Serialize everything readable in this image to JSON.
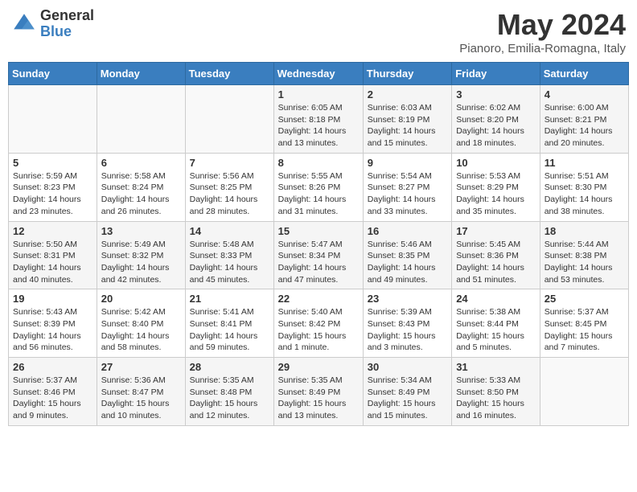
{
  "logo": {
    "general": "General",
    "blue": "Blue"
  },
  "header": {
    "month": "May 2024",
    "location": "Pianoro, Emilia-Romagna, Italy"
  },
  "weekdays": [
    "Sunday",
    "Monday",
    "Tuesday",
    "Wednesday",
    "Thursday",
    "Friday",
    "Saturday"
  ],
  "weeks": [
    [
      {
        "day": "",
        "info": ""
      },
      {
        "day": "",
        "info": ""
      },
      {
        "day": "",
        "info": ""
      },
      {
        "day": "1",
        "info": "Sunrise: 6:05 AM\nSunset: 8:18 PM\nDaylight: 14 hours\nand 13 minutes."
      },
      {
        "day": "2",
        "info": "Sunrise: 6:03 AM\nSunset: 8:19 PM\nDaylight: 14 hours\nand 15 minutes."
      },
      {
        "day": "3",
        "info": "Sunrise: 6:02 AM\nSunset: 8:20 PM\nDaylight: 14 hours\nand 18 minutes."
      },
      {
        "day": "4",
        "info": "Sunrise: 6:00 AM\nSunset: 8:21 PM\nDaylight: 14 hours\nand 20 minutes."
      }
    ],
    [
      {
        "day": "5",
        "info": "Sunrise: 5:59 AM\nSunset: 8:23 PM\nDaylight: 14 hours\nand 23 minutes."
      },
      {
        "day": "6",
        "info": "Sunrise: 5:58 AM\nSunset: 8:24 PM\nDaylight: 14 hours\nand 26 minutes."
      },
      {
        "day": "7",
        "info": "Sunrise: 5:56 AM\nSunset: 8:25 PM\nDaylight: 14 hours\nand 28 minutes."
      },
      {
        "day": "8",
        "info": "Sunrise: 5:55 AM\nSunset: 8:26 PM\nDaylight: 14 hours\nand 31 minutes."
      },
      {
        "day": "9",
        "info": "Sunrise: 5:54 AM\nSunset: 8:27 PM\nDaylight: 14 hours\nand 33 minutes."
      },
      {
        "day": "10",
        "info": "Sunrise: 5:53 AM\nSunset: 8:29 PM\nDaylight: 14 hours\nand 35 minutes."
      },
      {
        "day": "11",
        "info": "Sunrise: 5:51 AM\nSunset: 8:30 PM\nDaylight: 14 hours\nand 38 minutes."
      }
    ],
    [
      {
        "day": "12",
        "info": "Sunrise: 5:50 AM\nSunset: 8:31 PM\nDaylight: 14 hours\nand 40 minutes."
      },
      {
        "day": "13",
        "info": "Sunrise: 5:49 AM\nSunset: 8:32 PM\nDaylight: 14 hours\nand 42 minutes."
      },
      {
        "day": "14",
        "info": "Sunrise: 5:48 AM\nSunset: 8:33 PM\nDaylight: 14 hours\nand 45 minutes."
      },
      {
        "day": "15",
        "info": "Sunrise: 5:47 AM\nSunset: 8:34 PM\nDaylight: 14 hours\nand 47 minutes."
      },
      {
        "day": "16",
        "info": "Sunrise: 5:46 AM\nSunset: 8:35 PM\nDaylight: 14 hours\nand 49 minutes."
      },
      {
        "day": "17",
        "info": "Sunrise: 5:45 AM\nSunset: 8:36 PM\nDaylight: 14 hours\nand 51 minutes."
      },
      {
        "day": "18",
        "info": "Sunrise: 5:44 AM\nSunset: 8:38 PM\nDaylight: 14 hours\nand 53 minutes."
      }
    ],
    [
      {
        "day": "19",
        "info": "Sunrise: 5:43 AM\nSunset: 8:39 PM\nDaylight: 14 hours\nand 56 minutes."
      },
      {
        "day": "20",
        "info": "Sunrise: 5:42 AM\nSunset: 8:40 PM\nDaylight: 14 hours\nand 58 minutes."
      },
      {
        "day": "21",
        "info": "Sunrise: 5:41 AM\nSunset: 8:41 PM\nDaylight: 14 hours\nand 59 minutes."
      },
      {
        "day": "22",
        "info": "Sunrise: 5:40 AM\nSunset: 8:42 PM\nDaylight: 15 hours\nand 1 minute."
      },
      {
        "day": "23",
        "info": "Sunrise: 5:39 AM\nSunset: 8:43 PM\nDaylight: 15 hours\nand 3 minutes."
      },
      {
        "day": "24",
        "info": "Sunrise: 5:38 AM\nSunset: 8:44 PM\nDaylight: 15 hours\nand 5 minutes."
      },
      {
        "day": "25",
        "info": "Sunrise: 5:37 AM\nSunset: 8:45 PM\nDaylight: 15 hours\nand 7 minutes."
      }
    ],
    [
      {
        "day": "26",
        "info": "Sunrise: 5:37 AM\nSunset: 8:46 PM\nDaylight: 15 hours\nand 9 minutes."
      },
      {
        "day": "27",
        "info": "Sunrise: 5:36 AM\nSunset: 8:47 PM\nDaylight: 15 hours\nand 10 minutes."
      },
      {
        "day": "28",
        "info": "Sunrise: 5:35 AM\nSunset: 8:48 PM\nDaylight: 15 hours\nand 12 minutes."
      },
      {
        "day": "29",
        "info": "Sunrise: 5:35 AM\nSunset: 8:49 PM\nDaylight: 15 hours\nand 13 minutes."
      },
      {
        "day": "30",
        "info": "Sunrise: 5:34 AM\nSunset: 8:49 PM\nDaylight: 15 hours\nand 15 minutes."
      },
      {
        "day": "31",
        "info": "Sunrise: 5:33 AM\nSunset: 8:50 PM\nDaylight: 15 hours\nand 16 minutes."
      },
      {
        "day": "",
        "info": ""
      }
    ]
  ]
}
